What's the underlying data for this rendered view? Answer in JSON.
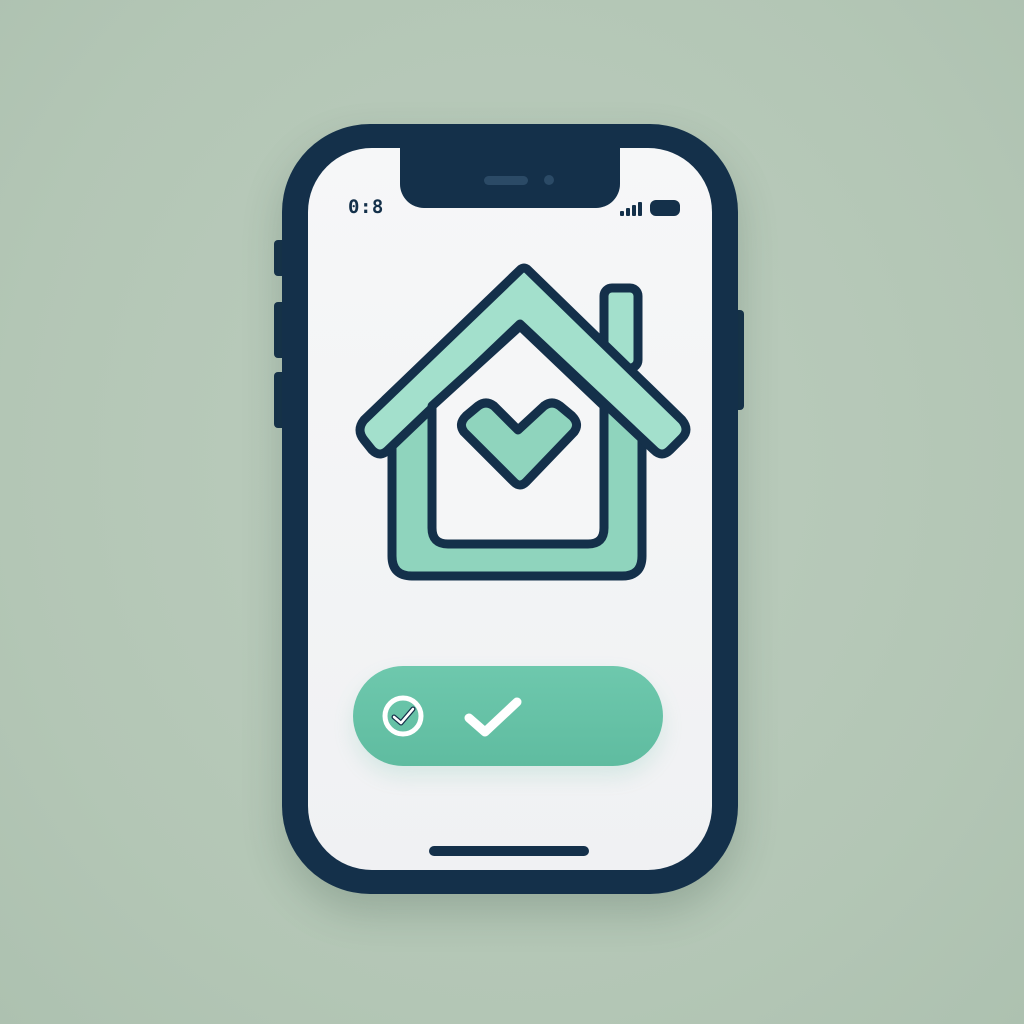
{
  "status_bar": {
    "time": "0:8",
    "signal_icon": "signal-bars-icon",
    "battery_icon": "battery-icon"
  },
  "hero": {
    "icon": "house-check-icon"
  },
  "confirm_button": {
    "leading_icon": "circle-check-icon",
    "trailing_icon": "check-icon"
  },
  "colors": {
    "background": "#b7c9b9",
    "phone_frame": "#14304a",
    "screen": "#f4f5f6",
    "accent": "#6ec8ad",
    "accent_light": "#a3e0cc"
  }
}
